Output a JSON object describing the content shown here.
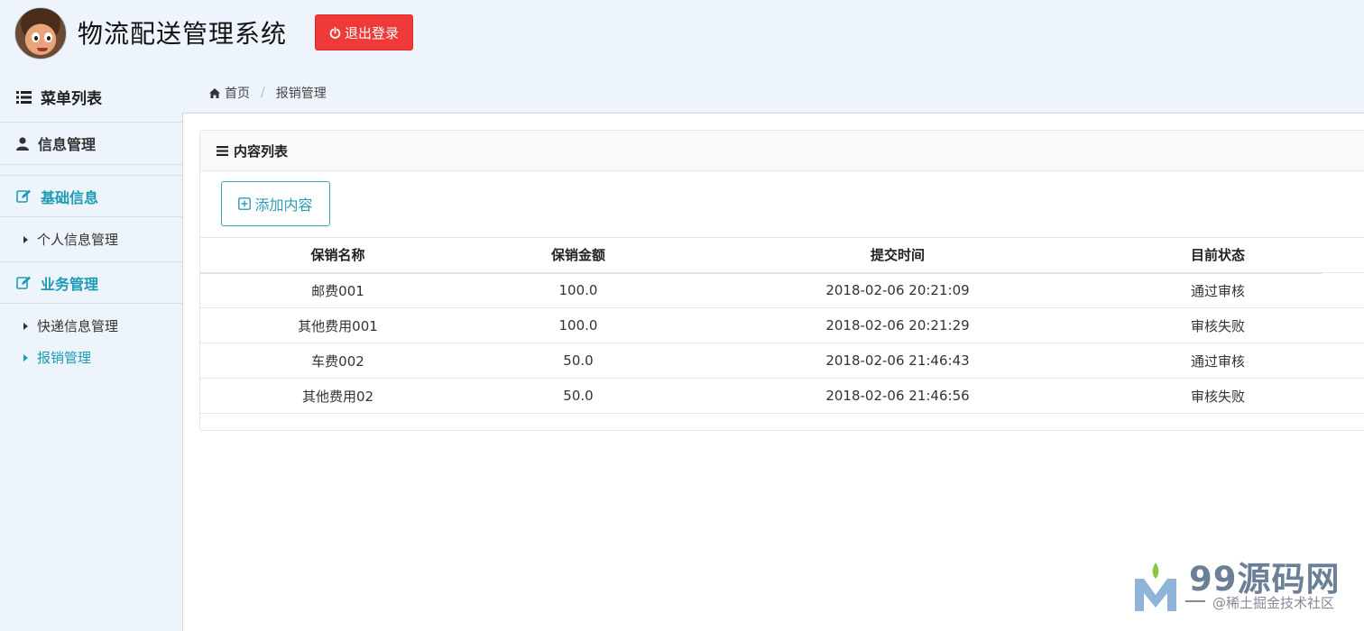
{
  "header": {
    "title": "物流配送管理系统",
    "logout_label": "退出登录"
  },
  "sidebar": {
    "heading": "菜单列表",
    "info_mgmt": "信息管理",
    "basic_info": "基础信息",
    "basic_info_items": [
      "个人信息管理"
    ],
    "business_mgmt": "业务管理",
    "business_items": [
      "快递信息管理",
      "报销管理"
    ],
    "active_item": "报销管理"
  },
  "breadcrumb": {
    "home": "首页",
    "current": "报销管理"
  },
  "panel": {
    "title": "内容列表",
    "add_label": "添加内容"
  },
  "table": {
    "columns": [
      "保销名称",
      "保销金额",
      "提交时间",
      "目前状态"
    ],
    "rows": [
      [
        "邮费001",
        "100.0",
        "2018-02-06 20:21:09",
        "通过审核"
      ],
      [
        "其他费用001",
        "100.0",
        "2018-02-06 20:21:29",
        "审核失败"
      ],
      [
        "车费002",
        "50.0",
        "2018-02-06 21:46:43",
        "通过审核"
      ],
      [
        "其他费用02",
        "50.0",
        "2018-02-06 21:46:56",
        "审核失败"
      ]
    ]
  },
  "watermark": {
    "text": "99源码网",
    "sub": "@稀土掘金技术社区"
  },
  "colors": {
    "accent": "#1b9bb6",
    "danger": "#f03a3a",
    "page_bg": "#edf4fb"
  }
}
